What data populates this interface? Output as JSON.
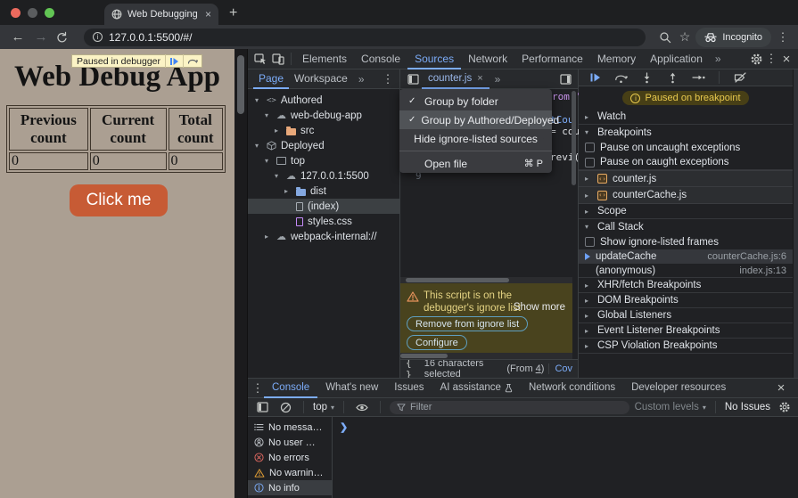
{
  "browser": {
    "tab_title": "Web Debugging Example",
    "url": "127.0.0.1:5500/#/",
    "incognito": "Incognito"
  },
  "page": {
    "banner": "Paused in debugger",
    "title": "Web Debug App",
    "table": {
      "headers": [
        "Previous count",
        "Current count",
        "Total count"
      ],
      "values": [
        "0",
        "0",
        "0"
      ]
    },
    "button": "Click me"
  },
  "devtools": {
    "tabs": [
      "Elements",
      "Console",
      "Sources",
      "Network",
      "Performance",
      "Memory",
      "Application"
    ],
    "navigator": {
      "tabs": [
        "Page",
        "Workspace"
      ],
      "tree": [
        {
          "label": "Authored"
        },
        {
          "label": "web-debug-app"
        },
        {
          "label": "src"
        },
        {
          "label": "Deployed"
        },
        {
          "label": "top"
        },
        {
          "label": "127.0.0.1:5500"
        },
        {
          "label": "dist"
        },
        {
          "label": "(index)"
        },
        {
          "label": "styles.css"
        },
        {
          "label": "webpack-internal://"
        }
      ]
    },
    "editor": {
      "tab": "counter.js",
      "line": "9",
      "frag1": "rom '",
      "frag2": "tCou",
      "frag3": "= cou",
      "frag4": "revi(",
      "ignore": {
        "line1": "This script is on the",
        "line2": "debugger's ignore list",
        "remove": "Remove from ignore list",
        "configure": "Configure",
        "show_more": "Show more"
      },
      "status": {
        "selection": "16 characters selected",
        "from_label": "(From",
        "from_num": "4",
        "from_close": ")",
        "coverage": "Cov"
      }
    },
    "menu": {
      "item1": "Group by folder",
      "item2": "Group by Authored/Deployed",
      "item3": "Hide ignore-listed sources",
      "item4": "Open file",
      "shortcut": "⌘ P"
    },
    "debugger": {
      "badge": "Paused on breakpoint",
      "watch": "Watch",
      "breakpoints": "Breakpoints",
      "cb1": "Pause on uncaught exceptions",
      "cb2": "Pause on caught exceptions",
      "bp1": "counter.js",
      "bp2": "counterCache.js",
      "scope": "Scope",
      "callstack": "Call Stack",
      "cb3": "Show ignore-listed frames",
      "frame1": {
        "name": "updateCache",
        "loc": "counterCache.js:6"
      },
      "frame2": {
        "name": "(anonymous)",
        "loc": "index.js:13"
      },
      "s1": "XHR/fetch Breakpoints",
      "s2": "DOM Breakpoints",
      "s3": "Global Listeners",
      "s4": "Event Listener Breakpoints",
      "s5": "CSP Violation Breakpoints"
    },
    "drawer": {
      "tabs": [
        "Console",
        "What's new",
        "Issues",
        "AI assistance",
        "Network conditions",
        "Developer resources"
      ],
      "context": "top",
      "filter_placeholder": "Filter",
      "custom_levels": "Custom levels",
      "no_issues": "No Issues",
      "sidebar": [
        {
          "label": "No messa…"
        },
        {
          "label": "No user …"
        },
        {
          "label": "No errors"
        },
        {
          "label": "No warnin…"
        },
        {
          "label": "No info"
        }
      ]
    }
  }
}
